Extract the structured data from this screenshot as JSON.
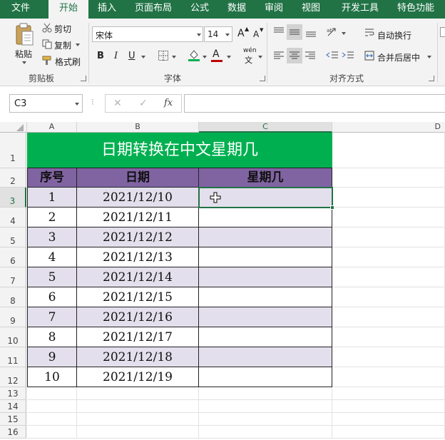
{
  "ribbon_tabs": [
    "文件",
    "开始",
    "插入",
    "页面布局",
    "公式",
    "数据",
    "审阅",
    "视图",
    "开发工具",
    "特色功能"
  ],
  "clipboard": {
    "paste": "粘贴",
    "cut": "剪切",
    "copy": "复制",
    "format_painter": "格式刷",
    "group": "剪贴板"
  },
  "font": {
    "name": "宋体",
    "size": "14",
    "grow": "A",
    "shrink": "A",
    "bold": "B",
    "italic": "I",
    "underline": "U",
    "fill_letter": "A",
    "phonetic_top": "wén",
    "phonetic_bottom": "文",
    "group": "字体"
  },
  "alignment": {
    "wrap_text": "自动换行",
    "merge_center": "合并后居中",
    "group": "对齐方式"
  },
  "name_box": "C3",
  "formula_bar": {
    "cancel": "✕",
    "enter": "✓",
    "fx": "fx",
    "value": ""
  },
  "columns": [
    "A",
    "B",
    "C",
    "D"
  ],
  "rows": [
    "1",
    "2",
    "3",
    "4",
    "5",
    "6",
    "7",
    "8",
    "9",
    "10",
    "11",
    "12",
    "13",
    "14",
    "15",
    "16"
  ],
  "table": {
    "title": "日期转换在中文星期几",
    "headers": [
      "序号",
      "日期",
      "星期几"
    ],
    "records": [
      [
        "1",
        "2021/12/10",
        ""
      ],
      [
        "2",
        "2021/12/11",
        ""
      ],
      [
        "3",
        "2021/12/12",
        ""
      ],
      [
        "4",
        "2021/12/13",
        ""
      ],
      [
        "5",
        "2021/12/14",
        ""
      ],
      [
        "6",
        "2021/12/15",
        ""
      ],
      [
        "7",
        "2021/12/16",
        ""
      ],
      [
        "8",
        "2021/12/17",
        ""
      ],
      [
        "9",
        "2021/12/18",
        ""
      ],
      [
        "10",
        "2021/12/19",
        ""
      ]
    ]
  },
  "colors": {
    "accent": "#217346",
    "title_fill": "#00b050",
    "header_fill": "#8064a2",
    "band_fill": "#e4dfec"
  }
}
